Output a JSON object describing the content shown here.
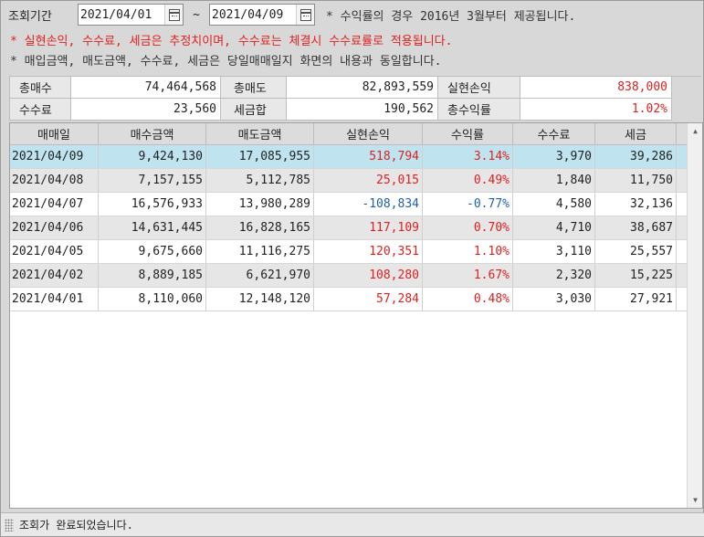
{
  "query": {
    "label": "조회기간",
    "start_date": "2021/04/01",
    "end_date": "2021/04/09",
    "separator": "~",
    "note": "* 수익률의 경우 2016년 3월부터 제공됩니다."
  },
  "notes": {
    "red": "* 실현손익, 수수료, 세금은 추정치이며, 수수료는 체결시 수수료률로 적용됩니다.",
    "black": "* 매입금액, 매도금액, 수수료, 세금은 당일매매일지 화면의 내용과 동일합니다."
  },
  "summary": {
    "total_buy_label": "총매수",
    "total_buy": "74,464,568",
    "total_sell_label": "총매도",
    "total_sell": "82,893,559",
    "realized_label": "실현손익",
    "realized": "838,000",
    "fee_label": "수수료",
    "fee": "23,560",
    "tax_label": "세금합",
    "tax": "190,562",
    "total_return_label": "총수익률",
    "total_return": "1.02%"
  },
  "grid": {
    "headers": [
      "매매일",
      "매수금액",
      "매도금액",
      "실현손익",
      "수익률",
      "수수료",
      "세금"
    ],
    "rows": [
      {
        "date": "2021/04/09",
        "buy": "9,424,130",
        "sell": "17,085,955",
        "pnl": "518,794",
        "rate": "3.14%",
        "fee": "3,970",
        "tax": "39,286",
        "sign": "pos"
      },
      {
        "date": "2021/04/08",
        "buy": "7,157,155",
        "sell": "5,112,785",
        "pnl": "25,015",
        "rate": "0.49%",
        "fee": "1,840",
        "tax": "11,750",
        "sign": "pos"
      },
      {
        "date": "2021/04/07",
        "buy": "16,576,933",
        "sell": "13,980,289",
        "pnl": "-108,834",
        "rate": "-0.77%",
        "fee": "4,580",
        "tax": "32,136",
        "sign": "neg"
      },
      {
        "date": "2021/04/06",
        "buy": "14,631,445",
        "sell": "16,828,165",
        "pnl": "117,109",
        "rate": "0.70%",
        "fee": "4,710",
        "tax": "38,687",
        "sign": "pos"
      },
      {
        "date": "2021/04/05",
        "buy": "9,675,660",
        "sell": "11,116,275",
        "pnl": "120,351",
        "rate": "1.10%",
        "fee": "3,110",
        "tax": "25,557",
        "sign": "pos"
      },
      {
        "date": "2021/04/02",
        "buy": "8,889,185",
        "sell": "6,621,970",
        "pnl": "108,280",
        "rate": "1.67%",
        "fee": "2,320",
        "tax": "15,225",
        "sign": "pos"
      },
      {
        "date": "2021/04/01",
        "buy": "8,110,060",
        "sell": "12,148,120",
        "pnl": "57,284",
        "rate": "0.48%",
        "fee": "3,030",
        "tax": "27,921",
        "sign": "pos"
      }
    ],
    "scroll_up_icon": "▲",
    "scroll_down_icon": "▼"
  },
  "status": {
    "message": "조회가 완료되었습니다."
  },
  "colors": {
    "positive": "#e02020",
    "negative": "#1f5fb0",
    "selected_row": "#bfe4ef"
  }
}
